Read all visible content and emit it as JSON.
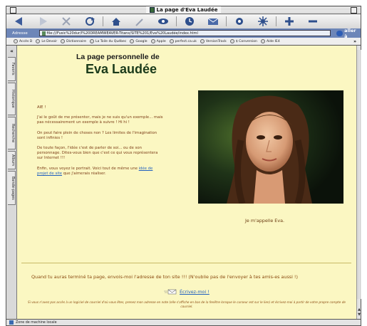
{
  "window": {
    "title": "La page d'Eva Laudée"
  },
  "toolbar": {
    "buttons": [
      "back-icon",
      "forward-icon",
      "stop-icon",
      "refresh-icon",
      "home-icon",
      "search-icon",
      "favorites-icon",
      "history-icon",
      "mail-icon",
      "print-icon",
      "settings-icon",
      "text-bigger-icon",
      "text-smaller-icon"
    ]
  },
  "address": {
    "label": "Adresse",
    "url": "file:///Fusic%20dur/I%20DREAMWEAVER-Titanx/SITE%201/Eva%20Laudée/index.html",
    "go_label": "aller à"
  },
  "favorites": [
    "Accès D",
    "Le Devoir",
    "Dictionnaire",
    "La Toile du Québec",
    "Google",
    "Apple",
    "perfect.ca.uk",
    "VersionTrack",
    "$ Conversion",
    "Aide IE4"
  ],
  "favorites_more": "»",
  "sidebar": {
    "collapse": "«",
    "tabs": [
      "Favoris",
      "Historique",
      "Recherche",
      "Album",
      "Bande-pages"
    ]
  },
  "page": {
    "heading_line1": "La page personnelle de",
    "heading_line2": "Eva Laudée",
    "intro": {
      "p1": "AIE !",
      "p2": "J'ai le goût de me présenter, mais je ne suis qu'un exemple... mais pas nécessairement un exemple à suivre ! Hi hi !",
      "p3": "On peut faire plein de choses non ? Les limites de l'imagination sont infinies !",
      "p4": "De toute façon, l'idée c'est de parler de soi... ou de son personnage. Dites-vous bien que c'est ce qui vous représentera sur Internet !!!",
      "p5_before": "Enfin, vous voyez le portrait. Voici tout de même une ",
      "p5_link": "idée de projet de site",
      "p5_after": " que j'aimerais réaliser."
    },
    "photo_caption": "Je m'appelle Eva.",
    "footer_main": "Quand tu auras terminé ta page, envois-moi l'adresse de ton site !!! (N'oublie pas de l'envoyer à tes amis-es aussi !)",
    "mail_link": "Écrivez-moi !",
    "footnote": "Si vous n'avez pas accès à un logiciel de courriel d'où vous êtes, prenez mon adresse en note (elle s'affiche en bas de la fenêtre lorsque le curseur est sur le lien) et écrivez-moi à partir de votre propre compte de courriel."
  },
  "status": {
    "text": "Zone de machine locale"
  },
  "colors": {
    "page_bg": "#fbf7c2",
    "heading": "#1a3a1a",
    "body_text": "#7a3a15",
    "link": "#1f5fbf",
    "address_bar": "#6d86b8"
  }
}
